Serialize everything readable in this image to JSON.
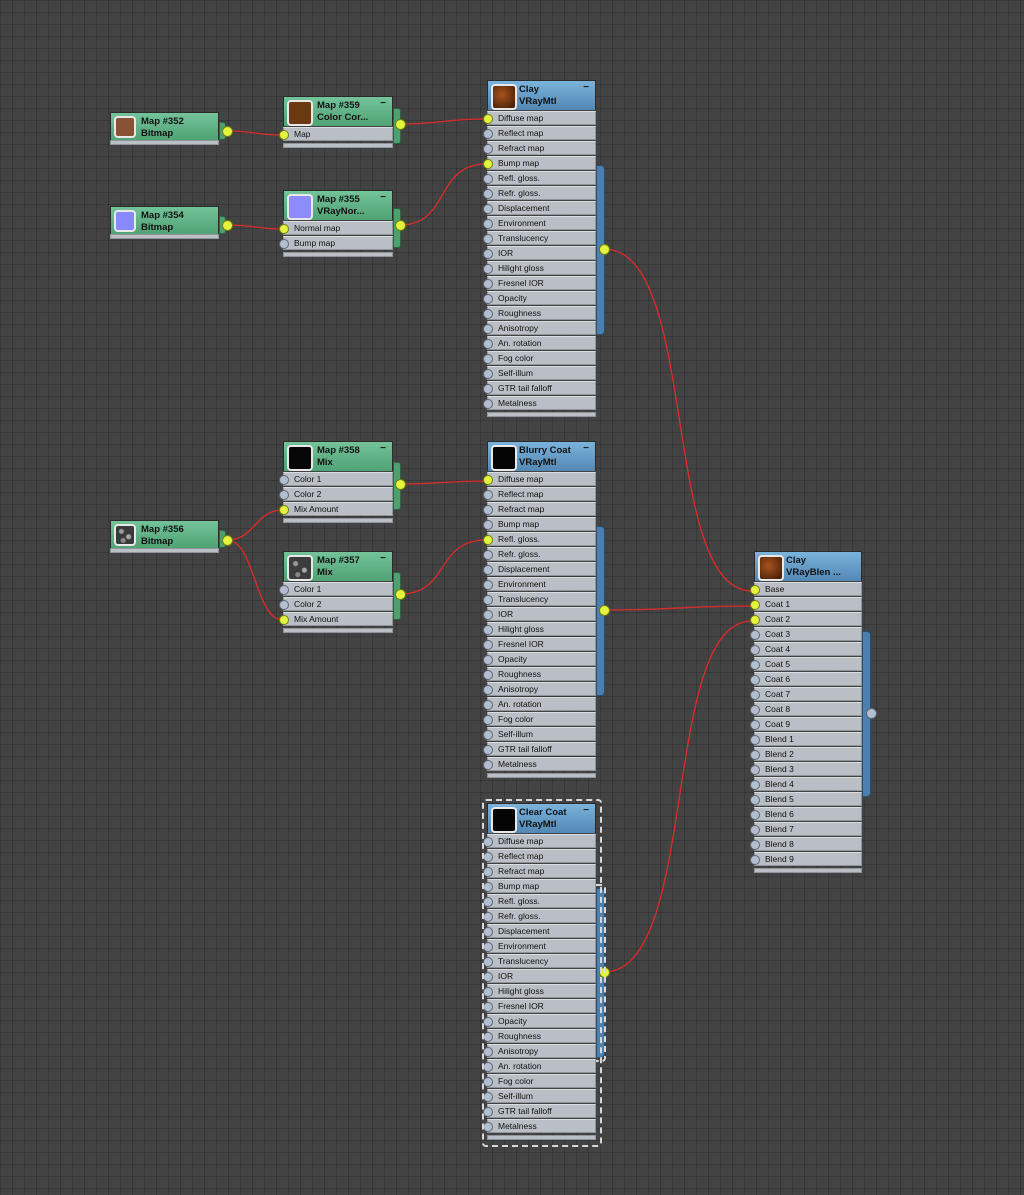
{
  "colors": {
    "canvas": "#434343",
    "map_header": "#5bb282",
    "material_header": "#5f92bf",
    "active_port": "#e4f33e",
    "inactive_port": "#b3bed0",
    "wire": "#e02a2a",
    "slot_bg": "#b9bfc5"
  },
  "maps": {
    "m352": {
      "name": "Map #352",
      "type": "Bitmap",
      "thumb_color": "#8a5235"
    },
    "m354": {
      "name": "Map #354",
      "type": "Bitmap",
      "thumb_color": "#8888ff"
    },
    "m356": {
      "name": "Map #356",
      "type": "Bitmap",
      "thumb_color": "#4a4a4a"
    },
    "m359": {
      "name": "Map #359",
      "type": "Color Cor...",
      "thumb_color": "#6b3a10",
      "slots": [
        "Map"
      ]
    },
    "m355": {
      "name": "Map #355",
      "type": "VRayNor...",
      "thumb_color": "#8c8cff",
      "slots": [
        "Normal map",
        "Bump map"
      ]
    },
    "m358": {
      "name": "Map #358",
      "type": "Mix",
      "thumb_color": "#070707",
      "slots": [
        "Color 1",
        "Color 2",
        "Mix Amount"
      ]
    },
    "m357": {
      "name": "Map #357",
      "type": "Mix",
      "thumb_color": "#3c3c3c",
      "slots": [
        "Color 1",
        "Color 2",
        "Mix Amount"
      ]
    }
  },
  "vray_slots": [
    "Diffuse map",
    "Reflect map",
    "Refract map",
    "Bump map",
    "Refl. gloss.",
    "Refr. gloss.",
    "Displacement",
    "Environment",
    "Translucency",
    "IOR",
    "Hilight gloss",
    "Fresnel IOR",
    "Opacity",
    "Roughness",
    "Anisotropy",
    "An. rotation",
    "Fog color",
    "Self-illum",
    "GTR tail falloff",
    "Metalness"
  ],
  "materials": {
    "clay": {
      "name": "Clay",
      "type": "VRayMtl",
      "thumb_color": "#6b3310"
    },
    "blurry": {
      "name": "Blurry Coat",
      "type": "VRayMtl",
      "thumb_color": "#050505"
    },
    "clear": {
      "name": "Clear Coat",
      "type": "VRayMtl",
      "thumb_color": "#050505"
    },
    "blend": {
      "name": "Clay",
      "type": "VRayBlen ...",
      "thumb_color": "#6b3310"
    }
  },
  "blend_slots": [
    "Base",
    "Coat 1",
    "Coat 2",
    "Coat 3",
    "Coat 4",
    "Coat 5",
    "Coat 6",
    "Coat 7",
    "Coat 8",
    "Coat 9",
    "Blend 1",
    "Blend 2",
    "Blend 3",
    "Blend 4",
    "Blend 5",
    "Blend 6",
    "Blend 7",
    "Blend 8",
    "Blend 9"
  ],
  "minimize_glyph": "−",
  "connections": [
    {
      "from": "Map #352",
      "to": "Map #359 / Map"
    },
    {
      "from": "Map #359",
      "to": "Clay / Diffuse map"
    },
    {
      "from": "Map #354",
      "to": "Map #355 / Normal map"
    },
    {
      "from": "Map #355",
      "to": "Clay / Bump map"
    },
    {
      "from": "Map #356",
      "to": "Map #358 / Mix Amount"
    },
    {
      "from": "Map #356",
      "to": "Map #357 / Mix Amount"
    },
    {
      "from": "Map #358",
      "to": "Blurry Coat / Diffuse map"
    },
    {
      "from": "Map #357",
      "to": "Blurry Coat / Refl. gloss."
    },
    {
      "from": "Clay VRayMtl",
      "to": "VRayBlend / Base"
    },
    {
      "from": "Blurry Coat",
      "to": "VRayBlend / Coat 1"
    },
    {
      "from": "Clear Coat",
      "to": "VRayBlend / Coat 2"
    }
  ]
}
